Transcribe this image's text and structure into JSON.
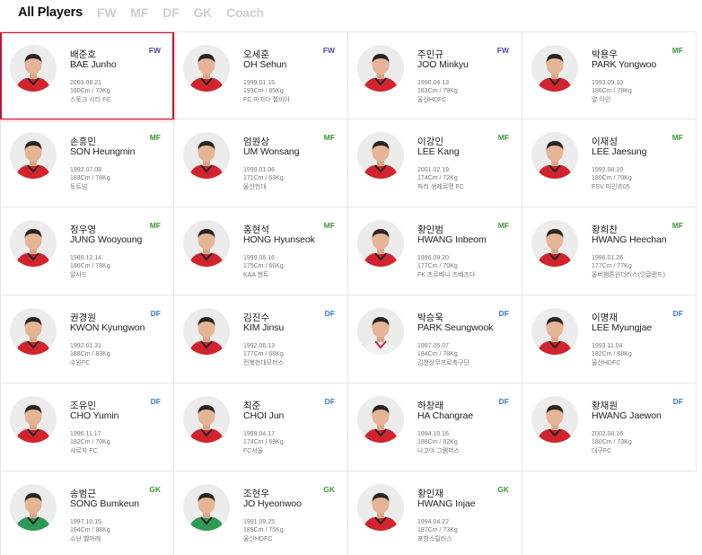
{
  "tabs": [
    {
      "label": "All Players",
      "active": true
    },
    {
      "label": "FW",
      "active": false
    },
    {
      "label": "MF",
      "active": false
    },
    {
      "label": "DF",
      "active": false
    },
    {
      "label": "GK",
      "active": false
    },
    {
      "label": "Coach",
      "active": false
    }
  ],
  "colors": {
    "FW": "#4a4aa8",
    "MF": "#3a9a3a",
    "DF": "#3a7ac8",
    "GK": "#3a9a3a",
    "selected_border": "#c8102e"
  },
  "players": [
    {
      "name_ko": "배준호",
      "name_en": "BAE Junho",
      "position": "FW",
      "birth": "2003.08.21",
      "body": "180Cm / 70Kg",
      "club": "스토크 시티 FC",
      "kit": "red",
      "selected": true
    },
    {
      "name_ko": "오세훈",
      "name_en": "OH Sehun",
      "position": "FW",
      "birth": "1999.01.15",
      "body": "193Cm / 85Kg",
      "club": "FC 마치다 젤비아",
      "kit": "red"
    },
    {
      "name_ko": "주민규",
      "name_en": "JOO Minkyu",
      "position": "FW",
      "birth": "1990.04.13",
      "body": "183Cm / 79Kg",
      "club": "울산HDFC",
      "kit": "red"
    },
    {
      "name_ko": "박용우",
      "name_en": "PARK Yongwoo",
      "position": "MF",
      "birth": "1993.09.10",
      "body": "186Cm / 79Kg",
      "club": "알 아인",
      "kit": "red"
    },
    {
      "name_ko": "손흥민",
      "name_en": "SON Heungmin",
      "position": "MF",
      "birth": "1992.07.08",
      "body": "183Cm / 78Kg",
      "club": "토트넘",
      "kit": "red"
    },
    {
      "name_ko": "엄원상",
      "name_en": "UM Wonsang",
      "position": "MF",
      "birth": "1999.01.06",
      "body": "171Cm / 63Kg",
      "club": "울산현대",
      "kit": "red"
    },
    {
      "name_ko": "이강인",
      "name_en": "LEE Kang",
      "position": "MF",
      "birth": "2001.02.19",
      "body": "174Cm / 72Kg",
      "club": "파리 생제르맹 FC",
      "kit": "red"
    },
    {
      "name_ko": "이재성",
      "name_en": "LEE Jaesung",
      "position": "MF",
      "birth": "1992.08.10",
      "body": "180Cm / 70Kg",
      "club": "FSV 마인츠05",
      "kit": "red"
    },
    {
      "name_ko": "정우영",
      "name_en": "JUNG Wooyoung",
      "position": "MF",
      "birth": "1989.12.14",
      "body": "186Cm / 78Kg",
      "club": "알사드",
      "kit": "red"
    },
    {
      "name_ko": "홍현석",
      "name_en": "HONG Hyunseok",
      "position": "MF",
      "birth": "1999.06.16",
      "body": "175Cm / 66Kg",
      "club": "KAA 헨트",
      "kit": "red"
    },
    {
      "name_ko": "황인범",
      "name_en": "HWANG Inbeom",
      "position": "MF",
      "birth": "1996.09.20",
      "body": "177Cm / 70Kg",
      "club": "FK 츠르베나 즈베즈다",
      "kit": "red"
    },
    {
      "name_ko": "황희찬",
      "name_en": "HWANG Heechan",
      "position": "MF",
      "birth": "1996.01.26",
      "body": "177Cm / 77Kg",
      "club": "울버햄튼원더러스(잉글랜드)",
      "kit": "red"
    },
    {
      "name_ko": "권경원",
      "name_en": "KWON Kyungwon",
      "position": "DF",
      "birth": "1992.01.31",
      "body": "188Cm / 83Kg",
      "club": "수원FC",
      "kit": "red"
    },
    {
      "name_ko": "김진수",
      "name_en": "KIM Jinsu",
      "position": "DF",
      "birth": "1992.06.13",
      "body": "177Cm / 68Kg",
      "club": "전북현대모터스",
      "kit": "red"
    },
    {
      "name_ko": "박승욱",
      "name_en": "PARK Seungwook",
      "position": "DF",
      "birth": "1997.05.07",
      "body": "184Cm / 78Kg",
      "club": "김천상무프로축구단",
      "kit": "white"
    },
    {
      "name_ko": "이명재",
      "name_en": "LEE Myungjae",
      "position": "DF",
      "birth": "1993.11.04",
      "body": "182Cm / 68Kg",
      "club": "울산HDFC",
      "kit": "red"
    },
    {
      "name_ko": "조유민",
      "name_en": "CHO Yumin",
      "position": "DF",
      "birth": "1996.11.17",
      "body": "182Cm / 70Kg",
      "club": "샤르자 FC",
      "kit": "red"
    },
    {
      "name_ko": "최준",
      "name_en": "CHOI Jun",
      "position": "DF",
      "birth": "1999.04.17",
      "body": "174Cm / 69Kg",
      "club": "FC서울",
      "kit": "red"
    },
    {
      "name_ko": "하창래",
      "name_en": "HA Changrae",
      "position": "DF",
      "birth": "1994.10.16",
      "body": "188Cm / 82Kg",
      "club": "나고야 그램퍼스",
      "kit": "red"
    },
    {
      "name_ko": "황재원",
      "name_en": "HWANG Jaewon",
      "position": "DF",
      "birth": "2002.08.16",
      "body": "180Cm / 73Kg",
      "club": "대구FC",
      "kit": "red"
    },
    {
      "name_ko": "송범근",
      "name_en": "SONG Bumkeun",
      "position": "GK",
      "birth": "1997.10.15",
      "body": "194Cm / 88Kg",
      "club": "쇼난 벨마레",
      "kit": "green"
    },
    {
      "name_ko": "조현우",
      "name_en": "JO Hyeonwoo",
      "position": "GK",
      "birth": "1991.09.25",
      "body": "189Cm / 75Kg",
      "club": "울산HDFC",
      "kit": "green"
    },
    {
      "name_ko": "황인재",
      "name_en": "HWANG Injae",
      "position": "GK",
      "birth": "1994.04.22",
      "body": "187Cm / 73Kg",
      "club": "포항스틸러스",
      "kit": "red"
    }
  ]
}
